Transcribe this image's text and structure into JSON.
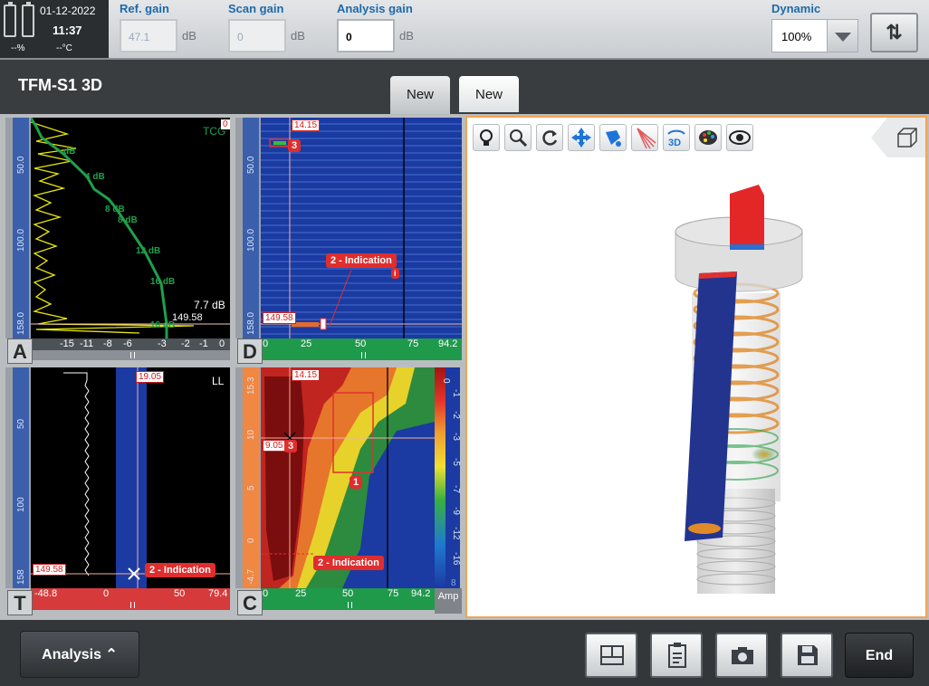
{
  "status": {
    "date": "01-12-2022",
    "time": "11:37",
    "battery_pct": "--%",
    "temperature": "--°C"
  },
  "gains": {
    "ref": {
      "label": "Ref. gain",
      "value": "47.1",
      "unit": "dB"
    },
    "scan": {
      "label": "Scan gain",
      "value": "0",
      "unit": "dB"
    },
    "analysis": {
      "label": "Analysis gain",
      "value": "0",
      "unit": "dB"
    }
  },
  "dynamic": {
    "label": "Dynamic",
    "value": "100%"
  },
  "page": {
    "title": "TFM-S1 3D"
  },
  "tabs": [
    {
      "label": "New"
    },
    {
      "label": "New"
    }
  ],
  "panelA": {
    "letter": "A",
    "mode": "TCG",
    "corner": "0",
    "y_ticks": [
      "50.0",
      "100.0",
      "158.0"
    ],
    "x_ticks": [
      "-15",
      "-11",
      "-8",
      "-6",
      "-3",
      "-2",
      "-1",
      "0"
    ],
    "tcg_points": [
      "dB",
      "4 dB",
      "8 dB",
      "8 dB",
      "12 dB",
      "16 dB",
      "16 dB"
    ],
    "gain_readout": "7.7 dB",
    "depth_readout": "149.58"
  },
  "panelD": {
    "letter": "D",
    "cursor_top": "14.15",
    "cursor_depth": "149.58",
    "y_ticks": [
      "50.0",
      "100.0",
      "158.0"
    ],
    "x_ticks": [
      "0",
      "25",
      "50",
      "75",
      "94.2"
    ],
    "indication": "2 - Indication",
    "tag3": "3"
  },
  "panelT": {
    "letter": "T",
    "mode": "LL",
    "cursor_top": "19.05",
    "cursor_depth": "149.58",
    "y_ticks": [
      "50",
      "100",
      "158"
    ],
    "x_ticks": [
      "-48.8",
      "0",
      "50",
      "79.4"
    ],
    "indication": "2 - Indication"
  },
  "panelC": {
    "letter": "C",
    "cursor_top": "14.15",
    "cursor_left": "9.05",
    "y_ticks": [
      "15.3",
      "10",
      "5",
      "0",
      "-4.7"
    ],
    "x_ticks": [
      "0",
      "25",
      "50",
      "75",
      "94.2"
    ],
    "indication": "2 - Indication",
    "tag1": "1",
    "tag3": "3",
    "amp_scale": [
      "0",
      "-1",
      "-2",
      "-3",
      "-5",
      "-7",
      "-9",
      "-12",
      "-16",
      "8"
    ],
    "amp_label": "Amp"
  },
  "toolbar3d": [
    "bulb-icon",
    "zoom-icon",
    "rotate-icon",
    "pan-icon",
    "paint-icon",
    "beam-icon",
    "3d-view-icon",
    "palette-icon",
    "eye-icon"
  ],
  "bottom": {
    "analysis": "Analysis",
    "end": "End"
  }
}
